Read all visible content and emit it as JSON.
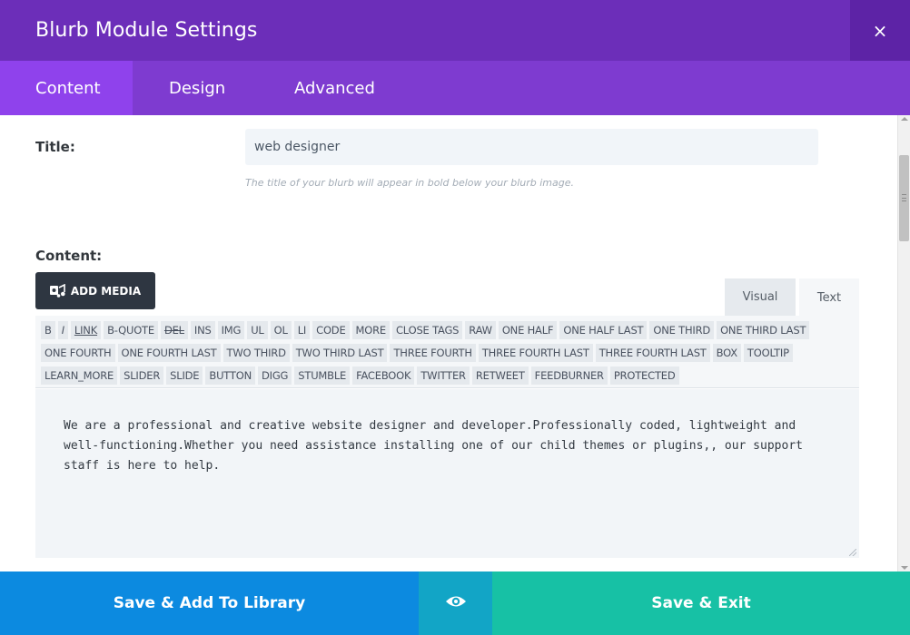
{
  "header": {
    "title": "Blurb Module Settings",
    "close_label": "×"
  },
  "tabs": [
    {
      "label": "Content",
      "active": true
    },
    {
      "label": "Design",
      "active": false
    },
    {
      "label": "Advanced",
      "active": false
    }
  ],
  "fields": {
    "title_label": "Title:",
    "title_value": "web designer",
    "title_description": "The title of your blurb will appear in bold below your blurb image.",
    "content_label": "Content:"
  },
  "editor": {
    "add_media_label": "ADD MEDIA",
    "visual_tab": "Visual",
    "text_tab": "Text",
    "toolbar_buttons": [
      "B",
      "I",
      "LINK",
      "B-QUOTE",
      "DEL",
      "INS",
      "IMG",
      "UL",
      "OL",
      "LI",
      "CODE",
      "MORE",
      "CLOSE TAGS",
      "RAW",
      "ONE HALF",
      "ONE HALF LAST",
      "ONE THIRD",
      "ONE THIRD LAST",
      "ONE FOURTH",
      "ONE FOURTH LAST",
      "TWO THIRD",
      "TWO THIRD LAST",
      "THREE FOURTH",
      "THREE FOURTH LAST",
      "THREE FOURTH LAST",
      "BOX",
      "TOOLTIP",
      "LEARN_MORE",
      "SLIDER",
      "SLIDE",
      "BUTTON",
      "DIGG",
      "STUMBLE",
      "FACEBOOK",
      "TWITTER",
      "RETWEET",
      "FEEDBURNER",
      "PROTECTED"
    ],
    "content_text": "We are a professional and creative website designer and developer.Professionally coded, lightweight and well-functioning.Whether you need assistance installing one of our child themes or plugins,, our support staff is here to help."
  },
  "footer": {
    "save_library_label": "Save & Add To Library",
    "preview_icon": "eye-icon",
    "save_exit_label": "Save & Exit"
  },
  "colors": {
    "header_bg": "#6c2eb9",
    "tabs_bg": "#7e3bd0",
    "active_tab_bg": "#8f42ec",
    "library_btn": "#0c8ae0",
    "preview_btn": "#12a5c6",
    "save_btn": "#17c1a5"
  }
}
